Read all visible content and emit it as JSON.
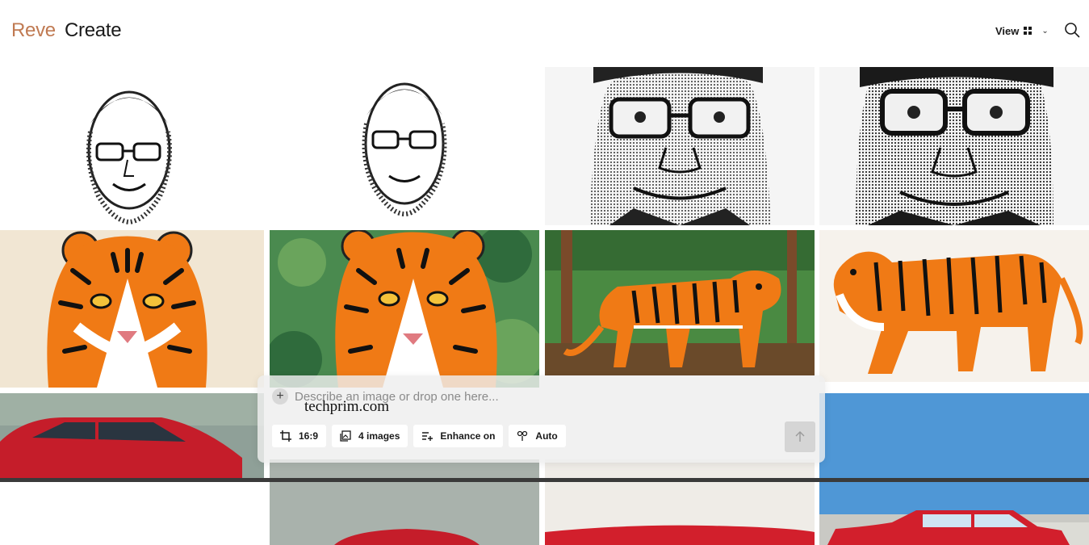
{
  "header": {
    "brand": "Reve",
    "title": "Create",
    "view_label": "View",
    "view_icon": "grid-icon",
    "search_icon": "search-icon"
  },
  "gallery": {
    "rows": [
      {
        "subject": "bill-gates-portrait",
        "items": [
          "ink sketch portrait small",
          "ink sketch portrait small",
          "stippled portrait close-up",
          "stippled portrait close-up"
        ]
      },
      {
        "subject": "tiger",
        "items": [
          "tiger face illustration",
          "tiger painting in jungle",
          "tiger walking in forest painting",
          "tiger walking on white"
        ]
      },
      {
        "subject": "red-car",
        "items": [
          "red sedan",
          "red car",
          "red car",
          "red classic car"
        ]
      }
    ]
  },
  "prompt": {
    "placeholder": "Describe an image or drop one here...",
    "watermark": "techprim.com",
    "options": [
      {
        "icon": "crop-icon",
        "label": "16:9"
      },
      {
        "icon": "images-icon",
        "label": "4 images"
      },
      {
        "icon": "enhance-icon",
        "label": "Enhance on"
      },
      {
        "icon": "model-icon",
        "label": "Auto"
      }
    ],
    "submit_icon": "arrow-up-icon"
  },
  "colors": {
    "brand": "#c07a52",
    "text": "#1a1a1a",
    "panel": "#eeeeee",
    "tiger_orange": "#f07a15"
  }
}
